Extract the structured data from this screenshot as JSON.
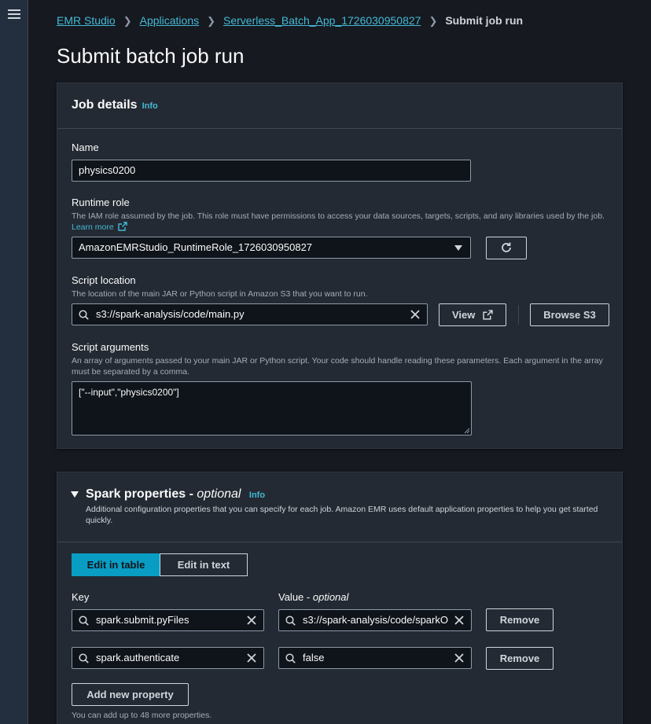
{
  "breadcrumb": {
    "items": [
      "EMR Studio",
      "Applications",
      "Serverless_Batch_App_1726030950827"
    ],
    "current": "Submit job run"
  },
  "page_title": "Submit batch job run",
  "job_details": {
    "title": "Job details",
    "info": "Info",
    "name_label": "Name",
    "name_value": "physics0200",
    "runtime_role_label": "Runtime role",
    "runtime_role_desc": "The IAM role assumed by the job. This role must have permissions to access your data sources, targets, scripts, and any libraries used by the job.",
    "learn_more": "Learn more",
    "runtime_role_value": "AmazonEMRStudio_RuntimeRole_1726030950827",
    "script_location_label": "Script location",
    "script_location_desc": "The location of the main JAR or Python script in Amazon S3 that you want to run.",
    "script_location_value": "s3://spark-analysis/code/main.py",
    "view_button": "View",
    "browse_s3_button": "Browse S3",
    "script_args_label": "Script arguments",
    "script_args_desc": "An array of arguments passed to your main JAR or Python script. Your code should handle reading these parameters. Each argument in the array must be separated by a comma.",
    "script_args_value": "[\"--input\",\"physics0200\"]"
  },
  "spark_properties": {
    "title": "Spark properties -",
    "optional": "optional",
    "info": "Info",
    "desc": "Additional configuration properties that you can specify for each job. Amazon EMR uses default application properties to help you get started quickly.",
    "tabs": [
      "Edit in table",
      "Edit in text"
    ],
    "key_label": "Key",
    "value_label": "Value -",
    "value_optional": "optional",
    "rows": [
      {
        "key": "spark.submit.pyFiles",
        "value": "s3://spark-analysis/code/sparkO",
        "remove": "Remove"
      },
      {
        "key": "spark.authenticate",
        "value": "false",
        "remove": "Remove"
      }
    ],
    "add_button": "Add new property",
    "hint": "You can add up to 48 more properties."
  },
  "colors": {
    "background": "#16191f",
    "panel": "#232a33",
    "link": "#44b9d6",
    "active_tab": "#0a9dc4"
  }
}
